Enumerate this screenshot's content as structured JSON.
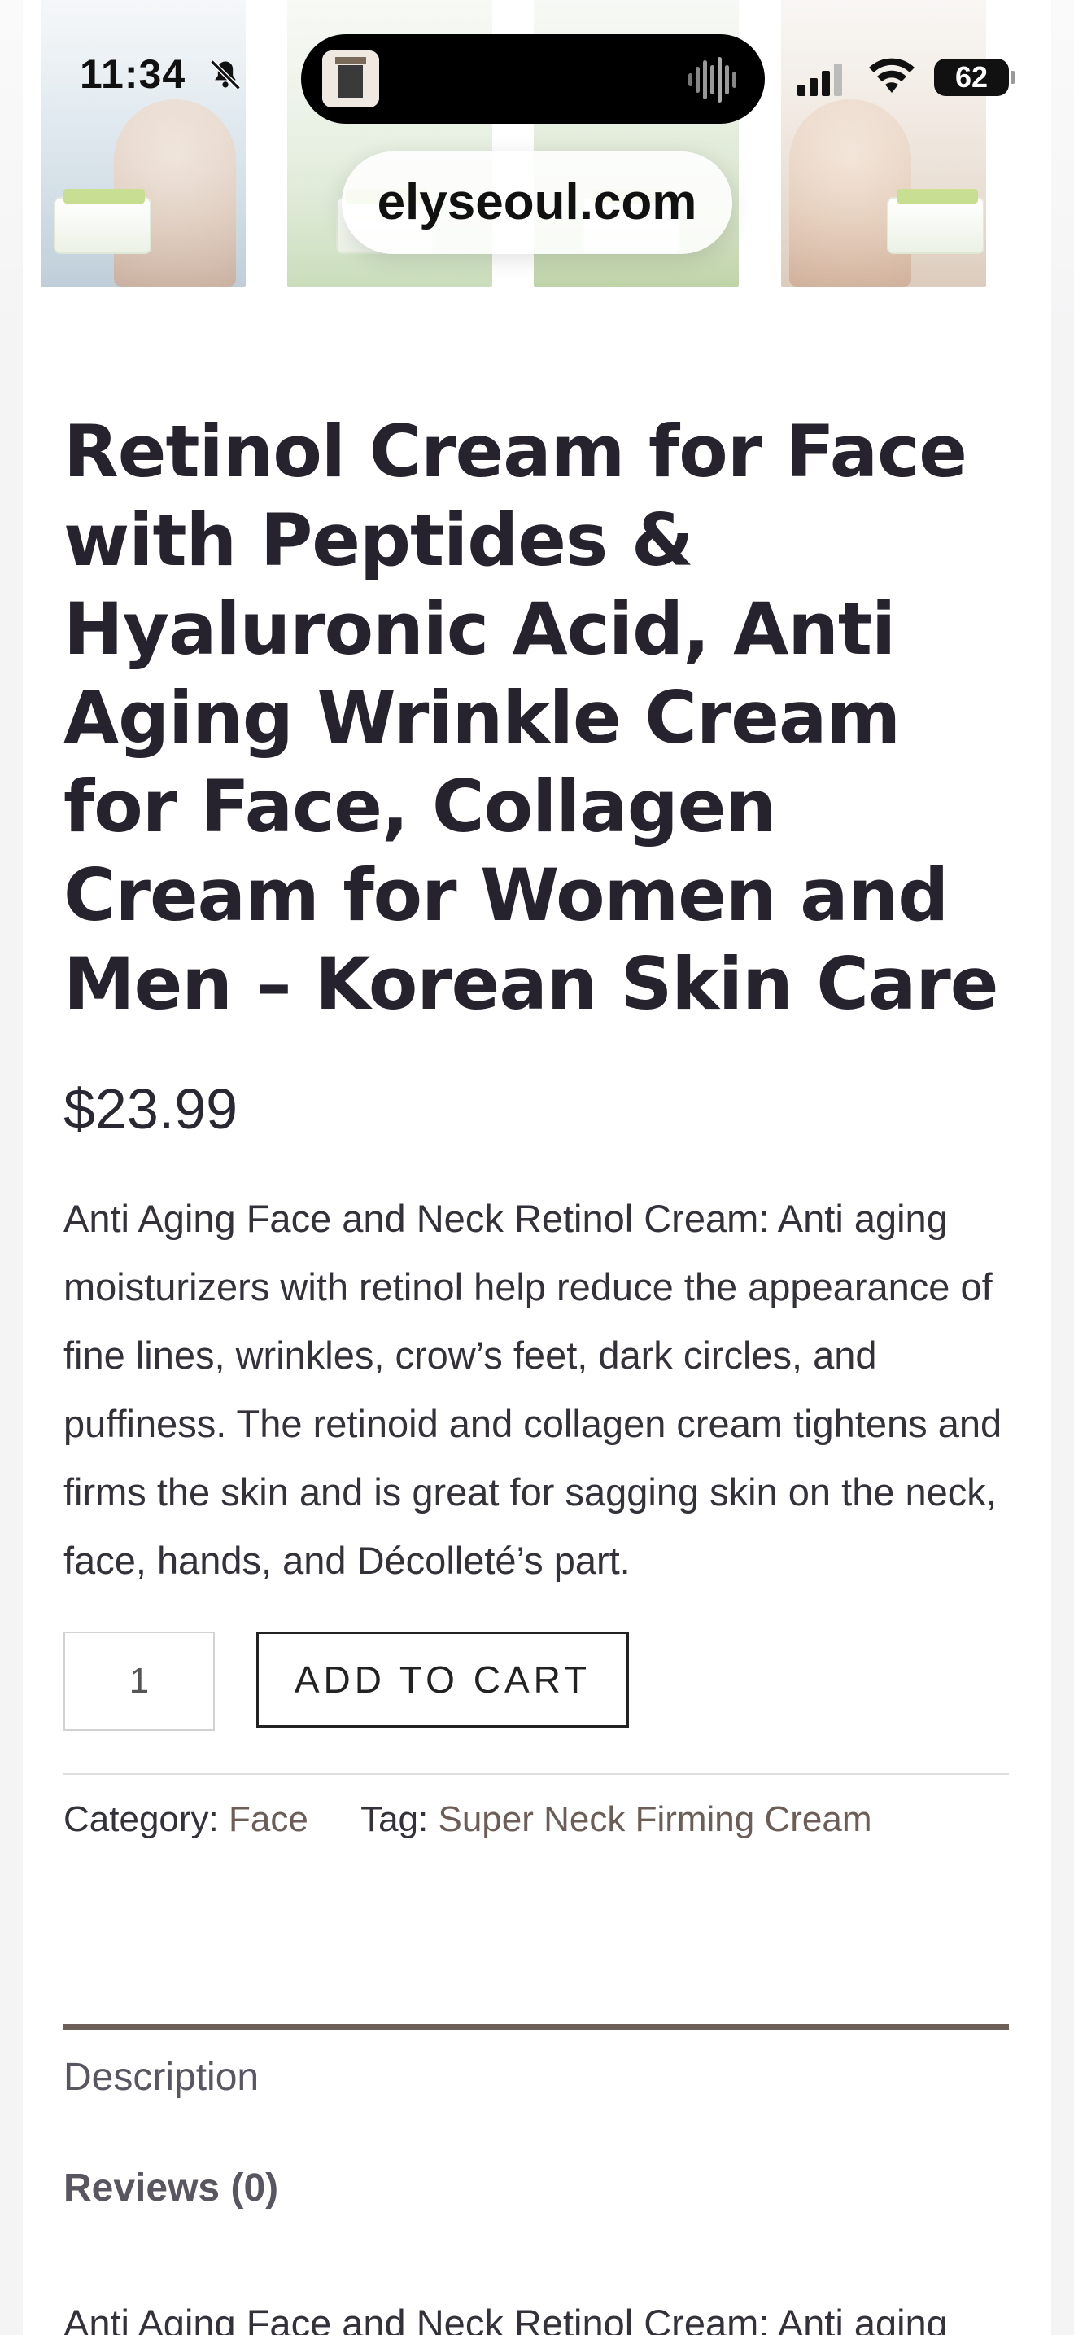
{
  "status_bar": {
    "time": "11:34",
    "battery": "62",
    "url": "elyseoul.com"
  },
  "product": {
    "title": "Retinol Cream for Face with Peptides & Hyaluronic Acid, Anti Aging Wrinkle Cream for Face, Collagen Cream for Women and Men – Korean Skin Care",
    "price": "$23.99",
    "short_description": "Anti Aging Face and Neck Retinol Cream: Anti aging moisturizers with retinol help reduce the appearance of fine lines, wrinkles, crow’s feet, dark circles, and puffiness. The retinoid and collagen cream tightens and firms the skin and is great for sagging skin on the neck, face, hands, and Décolleté’s part.",
    "quantity": "1",
    "add_to_cart_label": "ADD TO CART",
    "category_label": "Category:",
    "category_value": "Face",
    "tag_label": "Tag:",
    "tag_value": "Super Neck Firming Cream"
  },
  "tabs": {
    "description": "Description",
    "reviews": "Reviews (0)"
  },
  "description_preview": "Anti Aging Face and Neck Retinol Cream: Anti aging",
  "icons": {
    "bell": "bell-slash-icon",
    "signal": "cellular-signal-icon",
    "wifi": "wifi-icon",
    "battery": "battery-icon",
    "audio": "audio-waveform-icon"
  }
}
